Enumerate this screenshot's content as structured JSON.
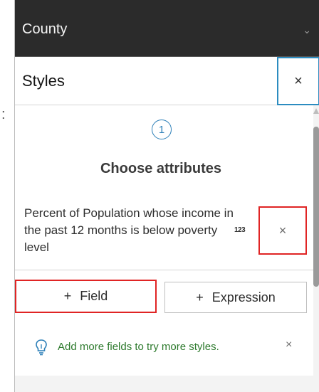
{
  "layer_header": {
    "title": "County",
    "chevron_icon": "chevron-down-icon"
  },
  "styles_bar": {
    "title": "Styles",
    "close_label": "×"
  },
  "step": {
    "number": "1",
    "title": "Choose attributes"
  },
  "attribute": {
    "name": "Percent of Population whose income in the past 12 months is below poverty level",
    "type_badge": "123",
    "remove_label": "×"
  },
  "buttons": {
    "field_plus": "+",
    "field_label": "Field",
    "expression_plus": "+",
    "expression_label": "Expression"
  },
  "tip": {
    "icon": "lightbulb-icon",
    "text": "Add more fields to try more styles.",
    "close_label": "×"
  },
  "colors": {
    "header_bg": "#2b2b2b",
    "focus_blue": "#2c8cc0",
    "highlight_red": "#e02424",
    "tip_green": "#2d7a2d"
  }
}
